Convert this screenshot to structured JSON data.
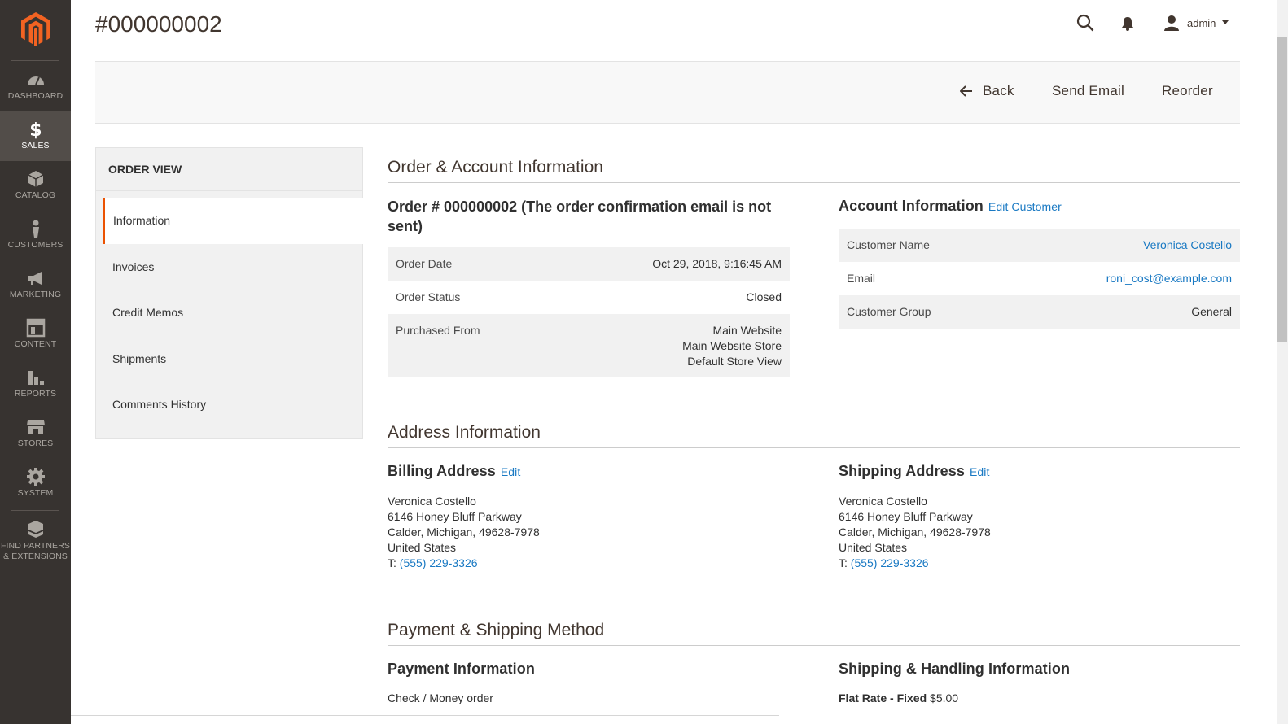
{
  "page_title": "#000000002",
  "topbar": {
    "user": "admin"
  },
  "nav": [
    {
      "label": "DASHBOARD",
      "icon": "dashboard-icon"
    },
    {
      "label": "SALES",
      "icon": "dollar-icon"
    },
    {
      "label": "CATALOG",
      "icon": "box-icon"
    },
    {
      "label": "CUSTOMERS",
      "icon": "person-icon"
    },
    {
      "label": "MARKETING",
      "icon": "megaphone-icon"
    },
    {
      "label": "CONTENT",
      "icon": "layout-icon"
    },
    {
      "label": "REPORTS",
      "icon": "bar-chart-icon"
    },
    {
      "label": "STORES",
      "icon": "storefront-icon"
    },
    {
      "label": "SYSTEM",
      "icon": "gear-icon"
    },
    {
      "label": "FIND PARTNERS",
      "label2": "& EXTENSIONS",
      "icon": "cube-stack-icon"
    }
  ],
  "actions": {
    "back": "Back",
    "send_email": "Send Email",
    "reorder": "Reorder"
  },
  "side": {
    "title": "ORDER VIEW",
    "tabs": [
      "Information",
      "Invoices",
      "Credit Memos",
      "Shipments",
      "Comments History"
    ]
  },
  "sections": {
    "order_account": "Order & Account Information",
    "address": "Address Information",
    "payment_shipping": "Payment & Shipping Method"
  },
  "order": {
    "title": "Order # 000000002 (The order confirmation email is not sent)",
    "date_label": "Order Date",
    "date_value": "Oct 29, 2018, 9:16:45 AM",
    "status_label": "Order Status",
    "status_value": "Closed",
    "purchased_label": "Purchased From",
    "purchased_lines": [
      "Main Website",
      "Main Website Store",
      "Default Store View"
    ]
  },
  "account": {
    "title": "Account Information",
    "edit": "Edit Customer",
    "name_label": "Customer Name",
    "name_value": "Veronica Costello",
    "email_label": "Email",
    "email_value": "roni_cost@example.com",
    "group_label": "Customer Group",
    "group_value": "General"
  },
  "billing": {
    "title": "Billing Address",
    "edit": "Edit",
    "lines": [
      "Veronica Costello",
      "6146 Honey Bluff Parkway",
      "Calder, Michigan, 49628-7978",
      "United States"
    ],
    "phone_prefix": "T: ",
    "phone": "(555) 229-3326"
  },
  "shipping": {
    "title": "Shipping Address",
    "edit": "Edit",
    "lines": [
      "Veronica Costello",
      "6146 Honey Bluff Parkway",
      "Calder, Michigan, 49628-7978",
      "United States"
    ],
    "phone_prefix": "T: ",
    "phone": "(555) 229-3326"
  },
  "payment": {
    "title": "Payment Information",
    "method": "Check / Money order"
  },
  "shipping_handling": {
    "title": "Shipping & Handling Information",
    "method_bold": "Flat Rate - Fixed",
    "price": "$5.00"
  },
  "colors": {
    "accent": "#eb5202",
    "link": "#1979c3",
    "sidebar": "#373330"
  }
}
